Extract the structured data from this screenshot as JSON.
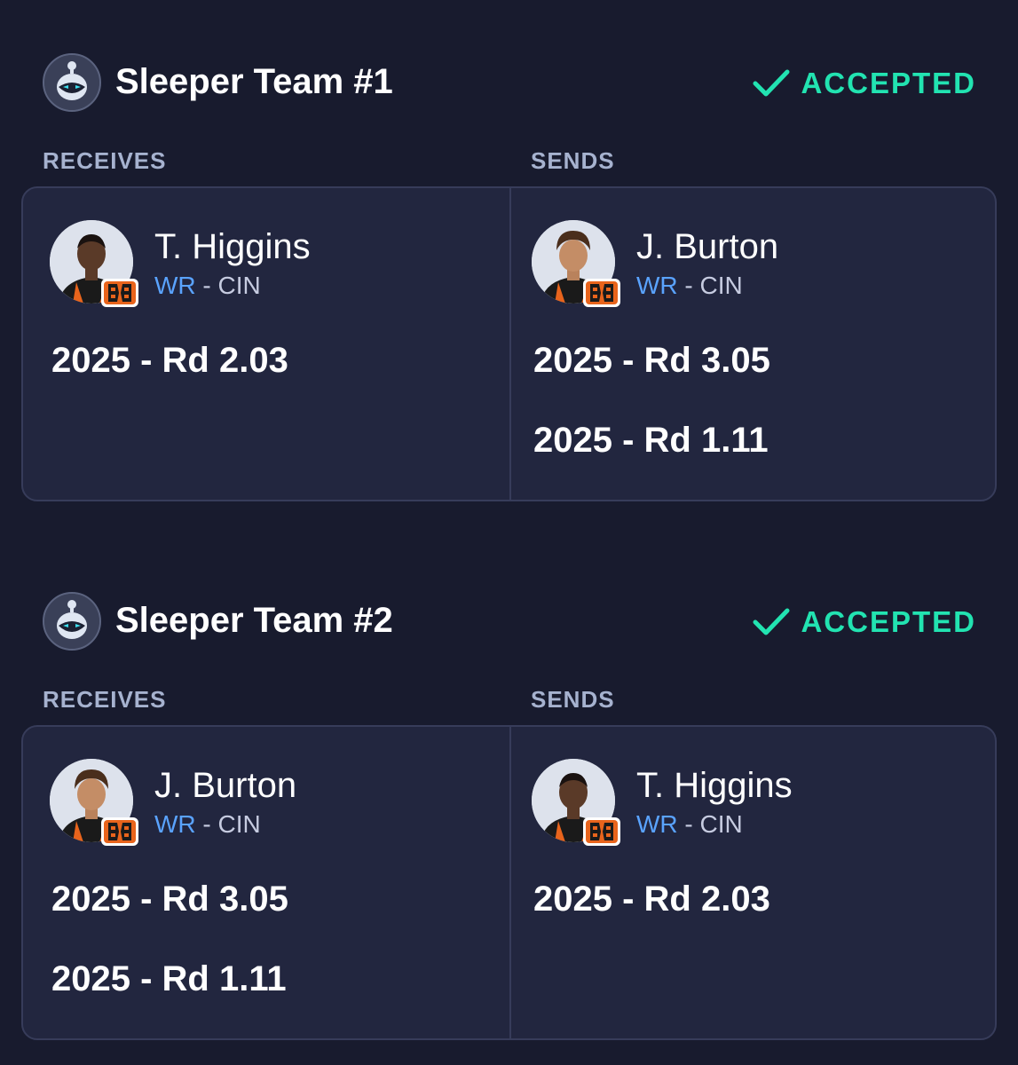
{
  "trades": [
    {
      "team_name": "Sleeper Team #1",
      "status": "ACCEPTED",
      "receives_label": "RECEIVES",
      "sends_label": "SENDS",
      "receives": {
        "player": {
          "name": "T. Higgins",
          "position": "WR",
          "separator": " - ",
          "team": "CIN"
        },
        "picks": [
          "2025 - Rd 2.03"
        ]
      },
      "sends": {
        "player": {
          "name": "J. Burton",
          "position": "WR",
          "separator": " - ",
          "team": "CIN"
        },
        "picks": [
          "2025 - Rd 3.05",
          "2025 - Rd 1.11"
        ]
      }
    },
    {
      "team_name": "Sleeper Team #2",
      "status": "ACCEPTED",
      "receives_label": "RECEIVES",
      "sends_label": "SENDS",
      "receives": {
        "player": {
          "name": "J. Burton",
          "position": "WR",
          "separator": " - ",
          "team": "CIN"
        },
        "picks": [
          "2025 - Rd 3.05",
          "2025 - Rd 1.11"
        ]
      },
      "sends": {
        "player": {
          "name": "T. Higgins",
          "position": "WR",
          "separator": " - ",
          "team": "CIN"
        },
        "picks": [
          "2025 - Rd 2.03"
        ]
      }
    }
  ],
  "colors": {
    "background": "#181b2e",
    "card": "#22263f",
    "accepted": "#22e3b1",
    "position": "#5aa3ff",
    "label": "#a6b2cf"
  }
}
